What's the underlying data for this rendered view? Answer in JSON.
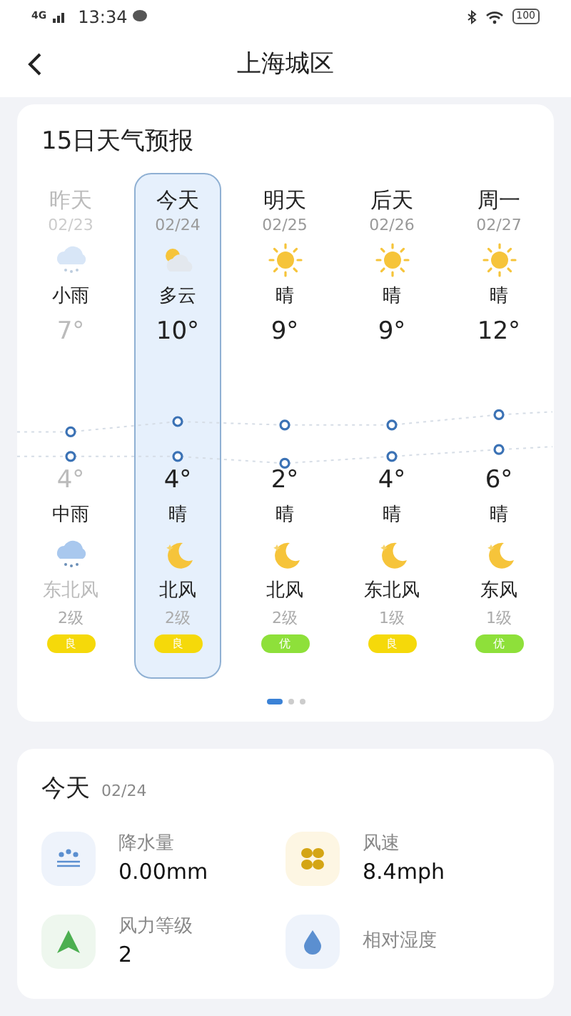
{
  "status_bar": {
    "network": "4G",
    "time": "13:34",
    "battery": "100"
  },
  "header": {
    "title": "上海城区"
  },
  "forecast": {
    "title": "15日天气预报",
    "days": [
      {
        "day": "昨天",
        "date": "02/23",
        "day_icon": {
          "kind": "light_rain"
        },
        "day_condition": "小雨",
        "high": "7°",
        "low": "4°",
        "night_condition": "中雨",
        "night_icon": {
          "kind": "rain"
        },
        "wind": "东北风",
        "wind_level": "2级",
        "aqi": {
          "label": "良",
          "color": "#f5d90a"
        },
        "selected": false,
        "past": true
      },
      {
        "day": "今天",
        "date": "02/24",
        "day_icon": {
          "kind": "partly_cloudy"
        },
        "day_condition": "多云",
        "high": "10°",
        "low": "4°",
        "night_condition": "晴",
        "night_icon": {
          "kind": "moon"
        },
        "wind": "北风",
        "wind_level": "2级",
        "aqi": {
          "label": "良",
          "color": "#f5d90a"
        },
        "selected": true,
        "past": false
      },
      {
        "day": "明天",
        "date": "02/25",
        "day_icon": {
          "kind": "sun"
        },
        "day_condition": "晴",
        "high": "9°",
        "low": "2°",
        "night_condition": "晴",
        "night_icon": {
          "kind": "moon"
        },
        "wind": "北风",
        "wind_level": "2级",
        "aqi": {
          "label": "优",
          "color": "#8ee03a"
        },
        "selected": false,
        "past": false
      },
      {
        "day": "后天",
        "date": "02/26",
        "day_icon": {
          "kind": "sun"
        },
        "day_condition": "晴",
        "high": "9°",
        "low": "4°",
        "night_condition": "晴",
        "night_icon": {
          "kind": "moon"
        },
        "wind": "东北风",
        "wind_level": "1级",
        "aqi": {
          "label": "良",
          "color": "#f5d90a"
        },
        "selected": false,
        "past": false
      },
      {
        "day": "周一",
        "date": "02/27",
        "day_icon": {
          "kind": "sun"
        },
        "day_condition": "晴",
        "high": "12°",
        "low": "6°",
        "night_condition": "晴",
        "night_icon": {
          "kind": "moon"
        },
        "wind": "东风",
        "wind_level": "1级",
        "aqi": {
          "label": "优",
          "color": "#8ee03a"
        },
        "selected": false,
        "past": false
      }
    ],
    "pages": [
      {
        "selected": true
      },
      {
        "selected": false
      },
      {
        "selected": false
      }
    ]
  },
  "today": {
    "title": "今天",
    "date": "02/24",
    "items": [
      {
        "kind": "precipitation",
        "label": "降水量",
        "value": "0.00mm"
      },
      {
        "kind": "wind_speed",
        "label": "风速",
        "value": "8.4mph"
      },
      {
        "kind": "wind_level",
        "label": "风力等级",
        "value": "2"
      },
      {
        "kind": "humidity",
        "label": "相对湿度"
      }
    ]
  }
}
